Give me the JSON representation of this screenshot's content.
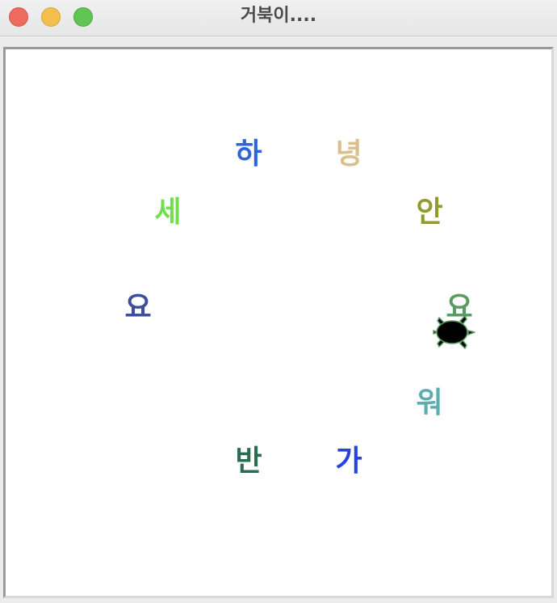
{
  "window": {
    "title": "거북이...."
  },
  "traffic_lights": [
    "close",
    "minimize",
    "zoom"
  ],
  "canvas": {
    "characters": [
      {
        "id": "ha",
        "text": "하",
        "color": "#2f63d8"
      },
      {
        "id": "nyeong",
        "text": "녕",
        "color": "#d9c08f"
      },
      {
        "id": "se",
        "text": "세",
        "color": "#6fe04d"
      },
      {
        "id": "an",
        "text": "안",
        "color": "#8f9b2e"
      },
      {
        "id": "yo-left",
        "text": "요",
        "color": "#3d4f97"
      },
      {
        "id": "yo-right",
        "text": "요",
        "color": "#5b9a61"
      },
      {
        "id": "wo",
        "text": "워",
        "color": "#5aaeb0"
      },
      {
        "id": "ban",
        "text": "반",
        "color": "#2c6b52"
      },
      {
        "id": "ga",
        "text": "가",
        "color": "#2643e0"
      }
    ],
    "turtle": {
      "icon": "turtle-icon",
      "fill": "#000000",
      "outline": "#5b9a61"
    }
  }
}
